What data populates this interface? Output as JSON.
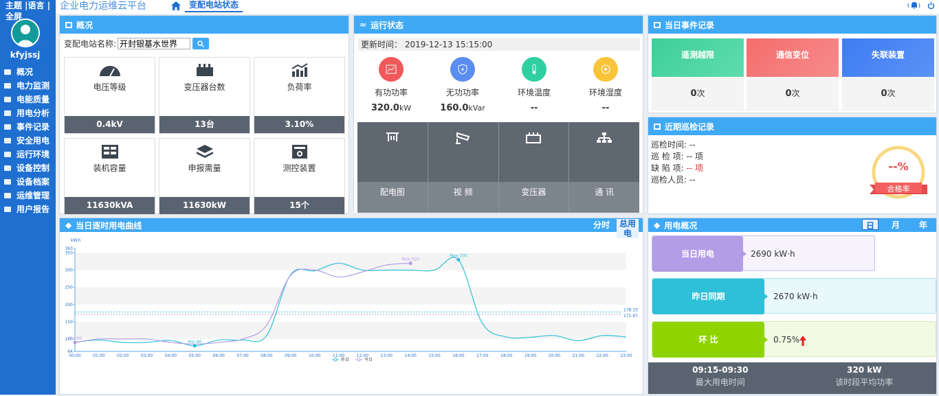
{
  "app": {
    "brand": "企业电力运维云平台",
    "tab": "变配电站状态",
    "topbar": "主题 |语言 | 全屏",
    "user": "kfyjssj"
  },
  "menu": [
    "概况",
    "电力监测",
    "电能质量",
    "用电分析",
    "事件记录",
    "安全用电",
    "运行环境",
    "设备控制",
    "设备档案",
    "运维管理",
    "用户报告"
  ],
  "overview": {
    "title": "概况",
    "station_label": "变配电站名称:",
    "station_value": "开封银基水世界",
    "cards": [
      {
        "label": "电压等级",
        "value": "0.4kV",
        "icon": "gauge-icon"
      },
      {
        "label": "变压器台数",
        "value": "13台",
        "icon": "transformer-icon"
      },
      {
        "label": "负荷率",
        "value": "3.10%",
        "icon": "chart-icon"
      },
      {
        "label": "装机容量",
        "value": "11630kVA",
        "icon": "cabinet-icon"
      },
      {
        "label": "申报需量",
        "value": "11630kW",
        "icon": "layers-icon"
      },
      {
        "label": "测控装置",
        "value": "15个",
        "icon": "device-icon"
      }
    ]
  },
  "status": {
    "title": "运行状态",
    "update_label": "更新时间：",
    "update_time": "2019-12-13 15:15:00",
    "items": [
      {
        "label": "有功功率",
        "value": "320.0",
        "unit": "kW",
        "color": "#f0595a"
      },
      {
        "label": "无功功率",
        "value": "160.0",
        "unit": "kVar",
        "color": "#5b8cf0"
      },
      {
        "label": "环境温度",
        "value": "--",
        "unit": "",
        "color": "#2fcfa0"
      },
      {
        "label": "环境湿度",
        "value": "--",
        "unit": "",
        "color": "#f8c53a"
      }
    ],
    "tiles": [
      "配电图",
      "视 频",
      "变压器",
      "通 讯"
    ]
  },
  "events": {
    "title": "当日事件记录",
    "items": [
      {
        "label": "遥测越限",
        "count": "0",
        "unit": "次",
        "color": "#3ecf9a"
      },
      {
        "label": "通信变位",
        "count": "0",
        "unit": "次",
        "color": "#f46d6d"
      },
      {
        "label": "失联装置",
        "count": "0",
        "unit": "次",
        "color": "#3d7cf2"
      }
    ]
  },
  "patrol": {
    "title": "近期巡检记录",
    "lines": [
      {
        "label": "巡检时间:",
        "value": "--"
      },
      {
        "label": "巡 检 项:",
        "value": "-- 项"
      },
      {
        "label": "缺 陷 项:",
        "value": "-- 项"
      },
      {
        "label": "巡检人员:",
        "value": "--"
      }
    ],
    "rate": "--%",
    "rate_label": "合格率"
  },
  "curve": {
    "title": "当日逐时用电曲线",
    "btn_time": "分时",
    "btn_total": "总用电"
  },
  "usage": {
    "title": "用电概况",
    "periods": [
      "日",
      "月",
      "年"
    ],
    "rows": [
      {
        "label": "当日用电",
        "value": "2690 kW·h",
        "color": "#b39de6",
        "bg": "#f6f3fc"
      },
      {
        "label": "昨日同期",
        "value": "2670 kW·h",
        "color": "#2ec0d8",
        "bg": "#e9f8fb"
      },
      {
        "label": "环 比",
        "value": "0.75%",
        "color": "#8fd400",
        "bg": "#f2fae4"
      }
    ],
    "footer": [
      {
        "value": "09:15-09:30",
        "label": "最大用电时间"
      },
      {
        "value": "320 kW",
        "label": "该时段平均功率"
      }
    ]
  },
  "chart_data": {
    "type": "line",
    "ylabel": "kW.h",
    "ylim": [
      64,
      363
    ],
    "yticks": [
      64,
      100,
      150,
      200,
      250,
      300,
      350,
      363
    ],
    "x": [
      "00:00",
      "01:00",
      "02:00",
      "03:00",
      "04:00",
      "05:00",
      "06:00",
      "07:00",
      "08:00",
      "09:00",
      "10:00",
      "11:00",
      "12:00",
      "13:00",
      "14:00",
      "15:00",
      "16:00",
      "17:00",
      "18:00",
      "19:00",
      "20:00",
      "21:00",
      "22:00",
      "23:00"
    ],
    "series": [
      {
        "name": "昨日",
        "color": "#2ec0d8",
        "values": [
          91,
          97,
          90,
          90,
          96,
          80,
          97,
          97,
          110,
          287,
          298,
          320,
          300,
          300,
          300,
          300,
          330,
          145,
          106,
          105,
          110,
          95,
          110,
          106
        ]
      },
      {
        "name": "今日",
        "color": "#b39de6",
        "values": [
          90,
          100,
          100,
          100,
          90,
          85,
          90,
          100,
          140,
          285,
          300,
          280,
          295,
          315,
          320
        ]
      }
    ],
    "annotations": [
      {
        "text": "Max:330",
        "series": "昨日",
        "index": 16
      },
      {
        "text": "Max:320",
        "series": "今日",
        "index": 14
      },
      {
        "text": "Min:80",
        "series": "昨日",
        "index": 5
      },
      {
        "text": "Min:90",
        "series": "今日",
        "index": 0
      }
    ],
    "average_lines": [
      {
        "value": 178.33,
        "text": "178.33"
      },
      {
        "value": 171.67,
        "text": "171.67"
      }
    ],
    "legend": "bottom-center"
  }
}
